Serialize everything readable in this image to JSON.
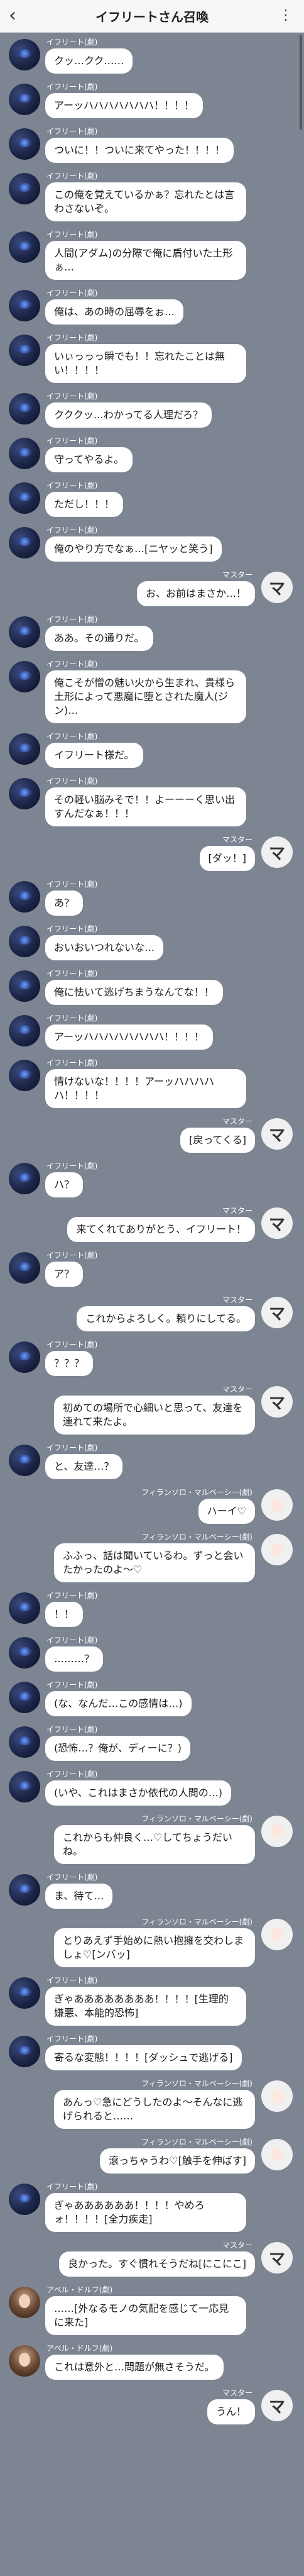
{
  "header": {
    "back_label": "‹",
    "title": "イフリートさん召喚",
    "menu_label": "⋮"
  },
  "messages": [
    {
      "side": "left",
      "speaker": "イフリート(劇)",
      "avatar": "ifrit",
      "text": "クッ…クク……"
    },
    {
      "side": "left",
      "speaker": "イフリート(劇)",
      "avatar": "ifrit",
      "text": "アーッハハハハハハハ！！！！"
    },
    {
      "side": "left",
      "speaker": "イフリート(劇)",
      "avatar": "ifrit",
      "text": "ついに！！ついに来てやった！！！！"
    },
    {
      "side": "left",
      "speaker": "イフリート(劇)",
      "avatar": "ifrit",
      "text": "この俺を覚えているかぁ？忘れたとは言わさないぞ。"
    },
    {
      "side": "left",
      "speaker": "イフリート(劇)",
      "avatar": "ifrit",
      "text": "人間(アダム)の分際で俺に盾付いた土形ぁ…"
    },
    {
      "side": "left",
      "speaker": "イフリート(劇)",
      "avatar": "ifrit",
      "text": "俺は、あの時の屈辱をぉ…"
    },
    {
      "side": "left",
      "speaker": "イフリート(劇)",
      "avatar": "ifrit",
      "text": "いぃっっっ瞬でも！！忘れたことは無い！！！！"
    },
    {
      "side": "left",
      "speaker": "イフリート(劇)",
      "avatar": "ifrit",
      "text": "クククッ…わかってる人理だろ？"
    },
    {
      "side": "left",
      "speaker": "イフリート(劇)",
      "avatar": "ifrit",
      "text": "守ってやるよ。"
    },
    {
      "side": "left",
      "speaker": "イフリート(劇)",
      "avatar": "ifrit",
      "text": "ただし！！！"
    },
    {
      "side": "left",
      "speaker": "イフリート(劇)",
      "avatar": "ifrit",
      "text": "俺のやり方でなぁ…[ニヤッと笑う]"
    },
    {
      "side": "right",
      "speaker": "マスター",
      "avatar": "master",
      "text": "お、お前はまさか…！"
    },
    {
      "side": "left",
      "speaker": "イフリート(劇)",
      "avatar": "ifrit",
      "text": "ああ。その通りだ。"
    },
    {
      "side": "left",
      "speaker": "イフリート(劇)",
      "avatar": "ifrit",
      "text": "俺こそが憎の魅い火から生まれ、貴様ら土形によって悪魔に堕とされた魔人(ジン)…"
    },
    {
      "side": "left",
      "speaker": "イフリート(劇)",
      "avatar": "ifrit",
      "text": "イフリート様だ。"
    },
    {
      "side": "left",
      "speaker": "イフリート(劇)",
      "avatar": "ifrit",
      "text": "その軽い脳みそで！！よーーーく思い出すんだなぁ！！！"
    },
    {
      "side": "right",
      "speaker": "マスター",
      "avatar": "master",
      "text": "[ダッ！]"
    },
    {
      "side": "left",
      "speaker": "イフリート(劇)",
      "avatar": "ifrit",
      "text": "あ？"
    },
    {
      "side": "left",
      "speaker": "イフリート(劇)",
      "avatar": "ifrit",
      "text": "おいおいつれないな…"
    },
    {
      "side": "left",
      "speaker": "イフリート(劇)",
      "avatar": "ifrit",
      "text": "俺に怯いて逃げちまうなんてな！！"
    },
    {
      "side": "left",
      "speaker": "イフリート(劇)",
      "avatar": "ifrit",
      "text": "アーッハハハハハハハハ！！！！"
    },
    {
      "side": "left",
      "speaker": "イフリート(劇)",
      "avatar": "ifrit",
      "text": "情けないな！！！！アーッハハハハハ！！！！"
    },
    {
      "side": "right",
      "speaker": "マスター",
      "avatar": "master",
      "text": "[戻ってくる]"
    },
    {
      "side": "left",
      "speaker": "イフリート(劇)",
      "avatar": "ifrit",
      "text": "ハ？"
    },
    {
      "side": "right",
      "speaker": "マスター",
      "avatar": "master",
      "text": "来てくれてありがとう、イフリート！"
    },
    {
      "side": "left",
      "speaker": "イフリート(劇)",
      "avatar": "ifrit",
      "text": "ア？"
    },
    {
      "side": "right",
      "speaker": "マスター",
      "avatar": "master",
      "text": "これからよろしく。頼りにしてる。"
    },
    {
      "side": "left",
      "speaker": "イフリート(劇)",
      "avatar": "ifrit",
      "text": "？？？"
    },
    {
      "side": "right",
      "speaker": "マスター",
      "avatar": "master",
      "text": "初めての場所で心細いと思って、友達を連れて来たよ。"
    },
    {
      "side": "left",
      "speaker": "イフリート(劇)",
      "avatar": "ifrit",
      "text": "と、友達…？"
    },
    {
      "side": "right",
      "speaker": "フィランソロ・マルベーシー(劇)",
      "avatar": "fran",
      "text": "ハーイ♡"
    },
    {
      "side": "right",
      "speaker": "フィランソロ・マルベーシー(劇)",
      "avatar": "fran",
      "text": "ふふっ、話は聞いているわ。ずっと会いたかったのよ〜♡"
    },
    {
      "side": "left",
      "speaker": "イフリート(劇)",
      "avatar": "ifrit",
      "text": "！！"
    },
    {
      "side": "left",
      "speaker": "イフリート(劇)",
      "avatar": "ifrit",
      "text": "………？"
    },
    {
      "side": "left",
      "speaker": "イフリート(劇)",
      "avatar": "ifrit",
      "text": "(な、なんだ…この感情は…)"
    },
    {
      "side": "left",
      "speaker": "イフリート(劇)",
      "avatar": "ifrit",
      "text": "(恐怖…？俺が、ディーに？)"
    },
    {
      "side": "left",
      "speaker": "イフリート(劇)",
      "avatar": "ifrit",
      "text": "(いや、これはまさか依代の人間の…)"
    },
    {
      "side": "right",
      "speaker": "フィランソロ・マルベーシー(劇)",
      "avatar": "fran",
      "text": "これからも仲良く…♡してちょうだいね。"
    },
    {
      "side": "left",
      "speaker": "イフリート(劇)",
      "avatar": "ifrit",
      "text": "ま、待て…"
    },
    {
      "side": "right",
      "speaker": "フィランソロ・マルベーシー(劇)",
      "avatar": "fran",
      "text": "とりあえず手始めに熱い抱擁を交わしましょ♡[ンバッ]"
    },
    {
      "side": "left",
      "speaker": "イフリート(劇)",
      "avatar": "ifrit",
      "text": "ぎゃああああああああ！！！！[生理的嫌悪、本能的恐怖]"
    },
    {
      "side": "left",
      "speaker": "イフリート(劇)",
      "avatar": "ifrit",
      "text": "寄るな変態！！！！[ダッシュで逃げる]"
    },
    {
      "side": "right",
      "speaker": "フィランソロ・マルベーシー(劇)",
      "avatar": "fran",
      "text": "あんっ♡急にどうしたのよ〜そんなに逃げられると……"
    },
    {
      "side": "right",
      "speaker": "フィランソロ・マルベーシー(劇)",
      "avatar": "fran",
      "text": "滾っちゃうわ♡[触手を伸ばす]"
    },
    {
      "side": "left",
      "speaker": "イフリート(劇)",
      "avatar": "ifrit",
      "text": "ぎゃああああああ！！！！やめろォ！！！！[全力疾走]"
    },
    {
      "side": "right",
      "speaker": "マスター",
      "avatar": "master",
      "text": "良かった。すぐ慣れそうだね[にこにこ]"
    },
    {
      "side": "left",
      "speaker": "アベル・ドルフ(劇)",
      "avatar": "abel",
      "text": "……[外なるモノの気配を感じて一応見に来た]"
    },
    {
      "side": "left",
      "speaker": "アベル・ドルフ(劇)",
      "avatar": "abel",
      "text": "これは意外と…問題が無さそうだ。"
    },
    {
      "side": "right",
      "speaker": "マスター",
      "avatar": "master",
      "text": "うん！"
    }
  ],
  "master_avatar_glyph": "マ",
  "colors": {
    "background": "#7d8593",
    "bubble": "#ffffff",
    "header": "#f7f7f7",
    "speaker_text": "#ffffff"
  }
}
